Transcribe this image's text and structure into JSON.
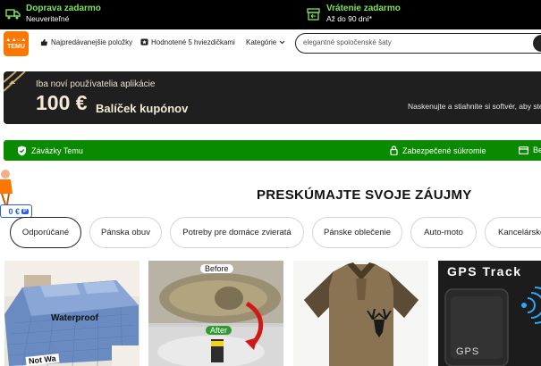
{
  "topbar": {
    "shipping_title": "Doprava zadarmo",
    "shipping_sub": "Neuveriteľné",
    "returns_title": "Vrátenie zadarmo",
    "returns_sub": "Až do 90 dní*"
  },
  "header": {
    "logo_text": "TEMU",
    "nav": [
      "Najpredávanejšie položky",
      "Hodnotené 5 hviezdičkami",
      "Kategórie"
    ],
    "search_placeholder": "elegantné spoločenské šaty"
  },
  "banner": {
    "small_text": "Iba noví používatelia aplikácie",
    "amount": "100 €",
    "package": "Balíček kupónov",
    "right_text": "Naskenujte a stiahnite si softvér, aby ste z"
  },
  "trust_bar": {
    "commitments": "Záväzky Temu",
    "privacy": "Zabezpečené súkromie",
    "third": "Be"
  },
  "price_badge": "0 €",
  "section_title": "PRESKÚMAJTE SVOJE ZÁUJMY",
  "categories": [
    "Odporúčané",
    "Pánska obuv",
    "Potreby pre domáce zvieratá",
    "Pánske oblečenie",
    "Auto-moto",
    "Kancelárske"
  ],
  "products": {
    "p1_label": "Waterproof",
    "p1_label2": "Not Wa",
    "p2_before": "Before",
    "p2_after": "After",
    "p4_title": "GPS Track",
    "p4_device": "GPS"
  },
  "colors": {
    "accent_green": "#0a8a00",
    "brand_orange": "#fb7701",
    "promo_green": "#7ee35a"
  }
}
